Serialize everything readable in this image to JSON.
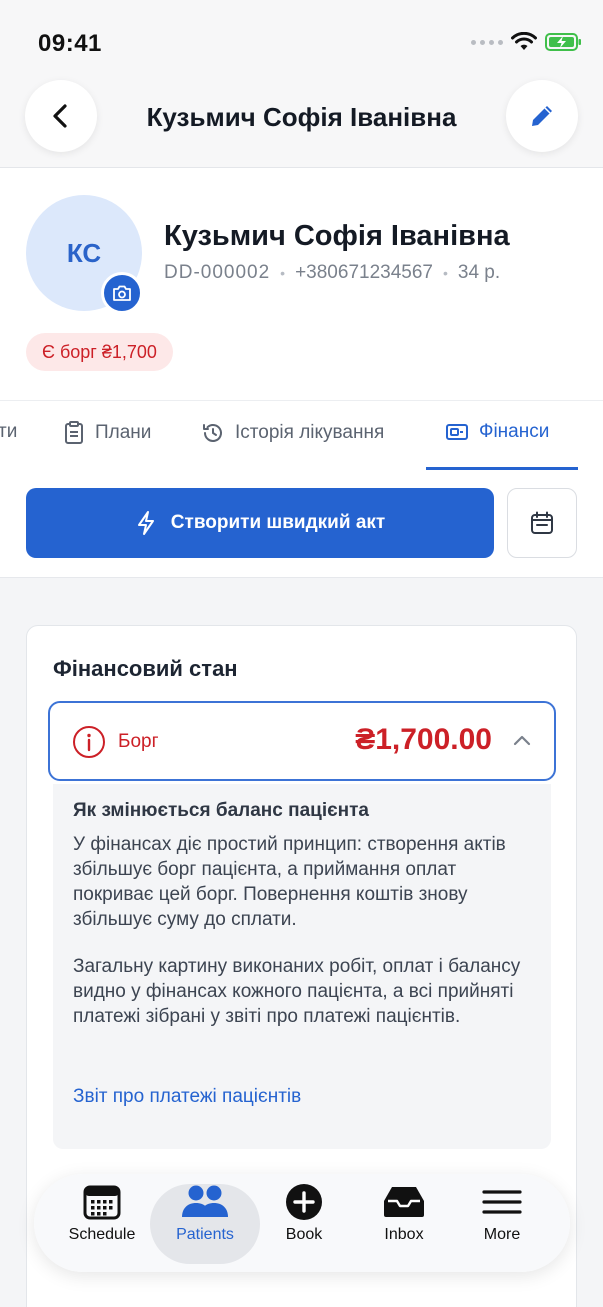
{
  "status_bar": {
    "time": "09:41"
  },
  "header": {
    "title": "Кузьмич Софія Іванівна"
  },
  "profile": {
    "initials": "КС",
    "name": "Кузьмич Софія Іванівна",
    "patient_id": "DD-000002",
    "phone": "+380671234567",
    "age": "34 р.",
    "debt_badge": "Є борг ₴1,700"
  },
  "tabs": [
    {
      "label": "ти"
    },
    {
      "label": "Плани"
    },
    {
      "label": "Історія лікування"
    },
    {
      "label": "Фінанси",
      "active": true
    }
  ],
  "actions": {
    "quick_act": "Створити швидкий акт"
  },
  "finance": {
    "title": "Фінансовий стан",
    "debt_label": "Борг",
    "debt_amount": "₴1,700.00",
    "explain_title": "Як змінюється баланс пацієнта",
    "explain_p1": "У фінансах діє простий принцип: створення актів збільшує борг пацієнта, а приймання оплат покриває цей борг. Повернення коштів знову збільшує суму до сплати.",
    "explain_p2": "Загальну картину виконаних робіт, оплат і балансу видно у фінансах кожного пацієнта, а всі прийняті платежі зібрані у звіті про платежі пацієнтів.",
    "report_link": "Звіт про платежі пацієнтів"
  },
  "bottom_nav": [
    {
      "label": "Schedule",
      "icon": "calendar-grid-icon"
    },
    {
      "label": "Patients",
      "icon": "people-icon",
      "active": true
    },
    {
      "label": "Book",
      "icon": "plus-circle-icon"
    },
    {
      "label": "Inbox",
      "icon": "inbox-tray-icon"
    },
    {
      "label": "More",
      "icon": "menu-icon"
    }
  ],
  "colors": {
    "accent": "#2563d0",
    "danger": "#cc2027",
    "avatar_bg": "#dce8fb"
  }
}
